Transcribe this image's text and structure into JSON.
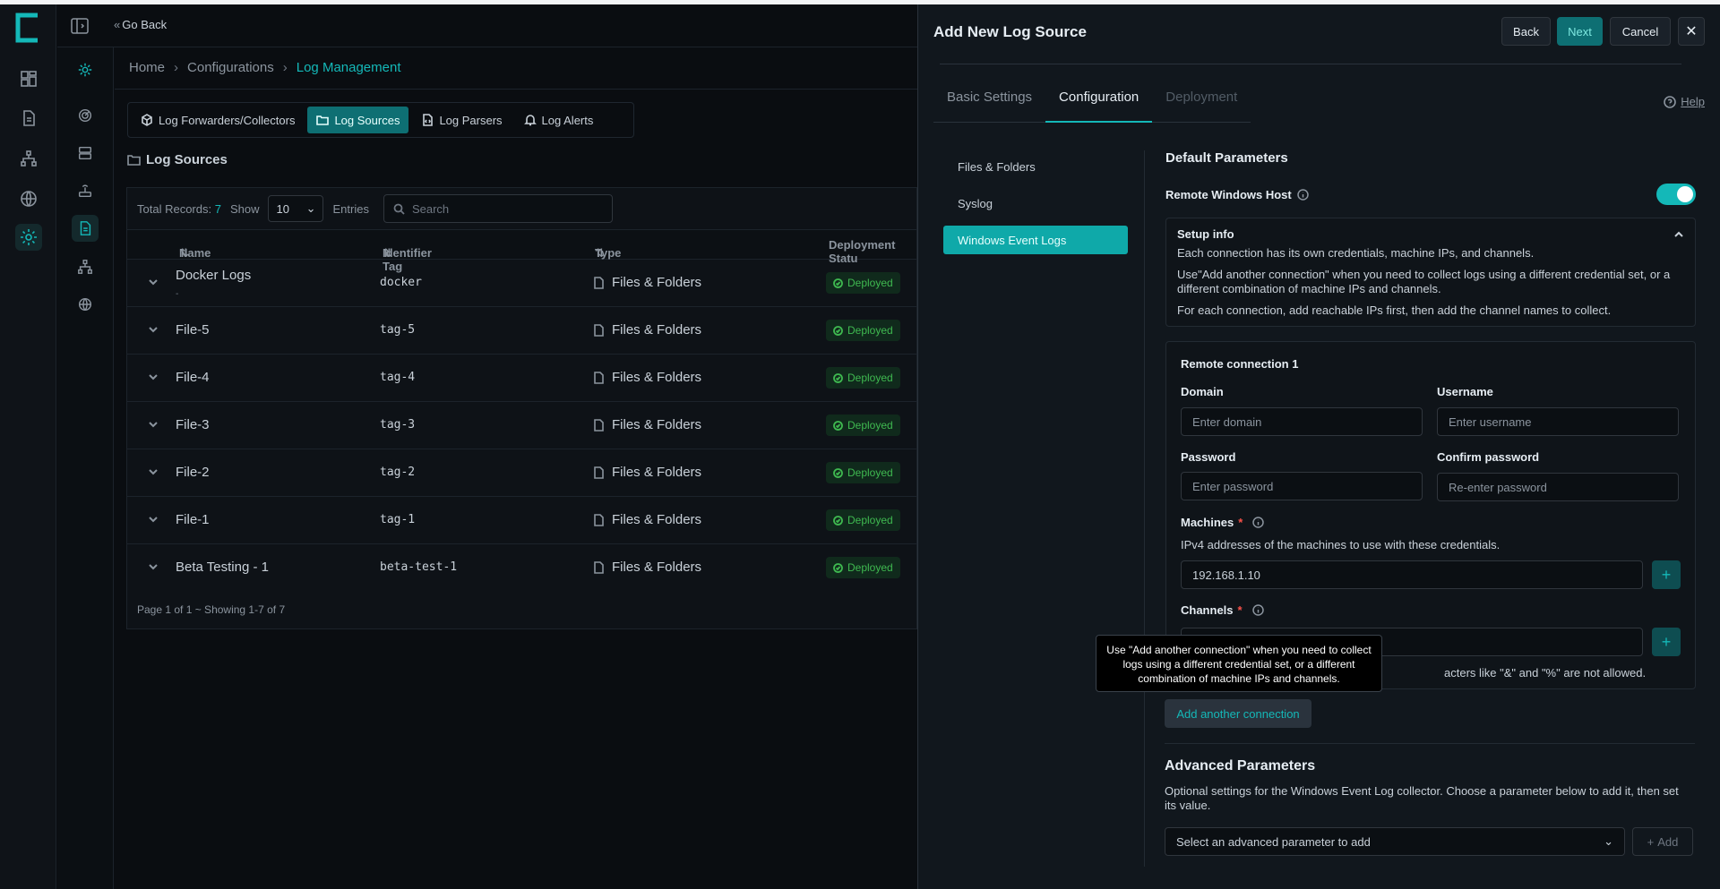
{
  "nav": {
    "go_back": "Go Back"
  },
  "breadcrumb": {
    "home": "Home",
    "configurations": "Configurations",
    "current": "Log Management"
  },
  "page_tabs": [
    {
      "label": "Log Forwarders/Collectors",
      "icon": "package-icon"
    },
    {
      "label": "Log Sources",
      "icon": "folder-icon"
    },
    {
      "label": "Log Parsers",
      "icon": "file-code-icon"
    },
    {
      "label": "Log Alerts",
      "icon": "bell-icon"
    }
  ],
  "section": {
    "title": "Log Sources"
  },
  "table": {
    "total_label": "Total Records:",
    "total": "7",
    "show_label": "Show",
    "page_size": "10",
    "entries_label": "Entries",
    "search_placeholder": "Search",
    "columns": {
      "name": "Name",
      "tag": "Identifier Tag",
      "type": "Type",
      "status": "Deployment Statu"
    },
    "rows": [
      {
        "name": "Docker Logs",
        "sub": "-",
        "tag": "docker",
        "type": "Files & Folders",
        "status": "Deployed"
      },
      {
        "name": "File-5",
        "tag": "tag-5",
        "type": "Files & Folders",
        "status": "Deployed"
      },
      {
        "name": "File-4",
        "tag": "tag-4",
        "type": "Files & Folders",
        "status": "Deployed"
      },
      {
        "name": "File-3",
        "tag": "tag-3",
        "type": "Files & Folders",
        "status": "Deployed"
      },
      {
        "name": "File-2",
        "tag": "tag-2",
        "type": "Files & Folders",
        "status": "Deployed"
      },
      {
        "name": "File-1",
        "tag": "tag-1",
        "type": "Files & Folders",
        "status": "Deployed"
      },
      {
        "name": "Beta Testing - 1",
        "tag": "beta-test-1",
        "type": "Files & Folders",
        "status": "Deployed"
      }
    ],
    "footer": "Page 1 of 1 ~ Showing 1-7 of 7"
  },
  "drawer": {
    "title": "Add New Log Source",
    "back": "Back",
    "next": "Next",
    "cancel": "Cancel",
    "tabs": {
      "basic": "Basic Settings",
      "configuration": "Configuration",
      "deployment": "Deployment"
    },
    "help": "Help",
    "subnav": [
      "Files & Folders",
      "Syslog",
      "Windows Event Logs"
    ],
    "default_params": "Default Parameters",
    "remote_windows_host": "Remote Windows Host",
    "remote_windows_host_on": true,
    "setup": {
      "title": "Setup info",
      "p1": "Each connection has its own credentials, machine IPs, and channels.",
      "p2": "Use\"Add another connection\" when you need to collect logs using a different credential set, or a different combination of machine IPs and channels.",
      "p3": "For each connection, add reachable IPs first, then add the channel names to collect."
    },
    "connection": {
      "title": "Remote connection 1",
      "domain_label": "Domain",
      "domain_placeholder": "Enter domain",
      "username_label": "Username",
      "username_placeholder": "Enter username",
      "password_label": "Password",
      "password_placeholder": "Enter password",
      "confirm_label": "Confirm password",
      "confirm_placeholder": "Re-enter password",
      "machines_label": "Machines",
      "machines_hint": "IPv4 addresses of the machines to use with these credentials.",
      "machines_value": "192.168.1.10",
      "channels_label": "Channels",
      "channels_hint_tail": "acters like \"&\" and \"%\" are not allowed."
    },
    "tooltip": "Use \"Add another connection\" when you need to collect logs using a different credential set, or a different combination of machine IPs and channels.",
    "add_connection": "Add another connection",
    "advanced": {
      "title": "Advanced Parameters",
      "desc": "Optional settings for the Windows Event Log collector. Choose a parameter below to add it, then set its value.",
      "select_placeholder": "Select an advanced parameter to add",
      "add": "Add"
    }
  },
  "colors": {
    "accent": "#14b8b8",
    "deployed": "#3fb950",
    "background": "#0a0d11"
  }
}
